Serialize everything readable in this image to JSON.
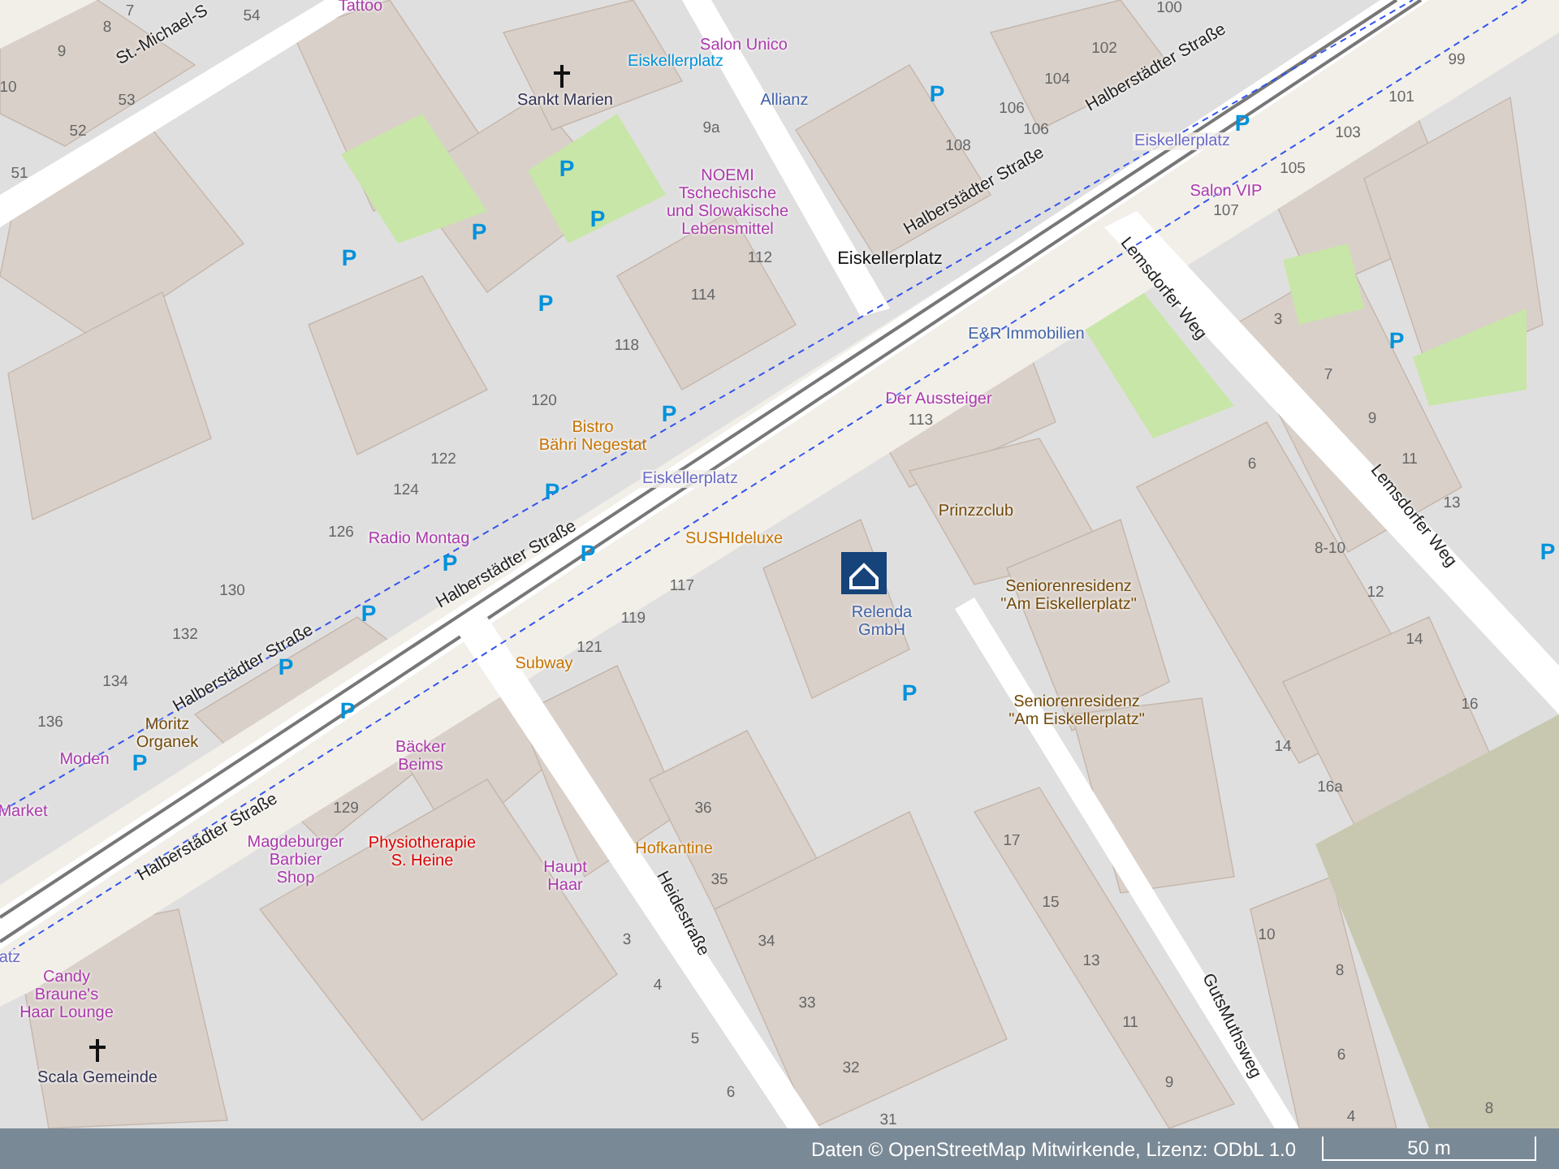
{
  "map": {
    "labels": [
      {
        "text": "St.-Michael-S",
        "kind": "street"
      },
      {
        "text": "Halberstädter Straße",
        "kind": "street"
      },
      {
        "text": "Halberstädter Straße",
        "kind": "street"
      },
      {
        "text": "Halberstädter Straße",
        "kind": "street"
      },
      {
        "text": "Halberstädter Straße",
        "kind": "street"
      },
      {
        "text": "Halberstädter Straße",
        "kind": "street"
      },
      {
        "text": "Lemsdorfer Weg",
        "kind": "street"
      },
      {
        "text": "Lemsdorfer Weg",
        "kind": "street"
      },
      {
        "text": "Heidestraße",
        "kind": "street"
      },
      {
        "text": "GutsMuthsweg",
        "kind": "street"
      },
      {
        "text": "Eiskellerplatz",
        "kind": "square"
      },
      {
        "text": "Tattoo",
        "kind": "shop"
      },
      {
        "text": "Salon Unico",
        "kind": "shop"
      },
      {
        "text": "Eiskellerplatz",
        "kind": "bus"
      },
      {
        "text": "Sankt Marien",
        "kind": "church"
      },
      {
        "text": "Allianz",
        "kind": "office"
      },
      {
        "text": "NOEMI\nTschechische\nund Slowakische\nLebensmittel",
        "kind": "shop"
      },
      {
        "text": "Eiskellerplatz",
        "kind": "tram"
      },
      {
        "text": "Salon VIP",
        "kind": "shop"
      },
      {
        "text": "E&R Immobilien",
        "kind": "office"
      },
      {
        "text": "Der Aussteiger",
        "kind": "shop"
      },
      {
        "text": "Bistro\nBähri Negestat",
        "kind": "food"
      },
      {
        "text": "Eiskellerplatz",
        "kind": "tram"
      },
      {
        "text": "Radio Montag",
        "kind": "shop"
      },
      {
        "text": "Prinzzclub",
        "kind": "leisure"
      },
      {
        "text": "SUSHIdeluxe",
        "kind": "food"
      },
      {
        "text": "Relenda\nGmbH",
        "kind": "office"
      },
      {
        "text": "Seniorenresidenz\n\"Am Eiskellerplatz\"",
        "kind": "leisure"
      },
      {
        "text": "Seniorenresidenz\n\"Am Eiskellerplatz\"",
        "kind": "leisure"
      },
      {
        "text": "Subway",
        "kind": "food"
      },
      {
        "text": "Moritz\nOrganek",
        "kind": "leisure"
      },
      {
        "text": "Moden",
        "kind": "shop"
      },
      {
        "text": "Market",
        "kind": "shop"
      },
      {
        "text": "Bäcker\nBeims",
        "kind": "shop"
      },
      {
        "text": "Magdeburger\nBarbier\nShop",
        "kind": "shop"
      },
      {
        "text": "Physiotherapie\nS. Heine",
        "kind": "health"
      },
      {
        "text": "Haupt\nHaar",
        "kind": "shop"
      },
      {
        "text": "Hofkantine",
        "kind": "food"
      },
      {
        "text": "Candy\nBraune's\nHaar Lounge",
        "kind": "shop"
      },
      {
        "text": "Scala Gemeinde",
        "kind": "church"
      },
      {
        "text": "atz",
        "kind": "tram"
      },
      {
        "text": "7",
        "kind": "number"
      },
      {
        "text": "8",
        "kind": "number"
      },
      {
        "text": "54",
        "kind": "number"
      },
      {
        "text": "9",
        "kind": "number"
      },
      {
        "text": "10",
        "kind": "number"
      },
      {
        "text": "53",
        "kind": "number"
      },
      {
        "text": "52",
        "kind": "number"
      },
      {
        "text": "51",
        "kind": "number"
      },
      {
        "text": "9a",
        "kind": "number"
      },
      {
        "text": "112",
        "kind": "number"
      },
      {
        "text": "114",
        "kind": "number"
      },
      {
        "text": "118",
        "kind": "number"
      },
      {
        "text": "120",
        "kind": "number"
      },
      {
        "text": "122",
        "kind": "number"
      },
      {
        "text": "124",
        "kind": "number"
      },
      {
        "text": "126",
        "kind": "number"
      },
      {
        "text": "130",
        "kind": "number"
      },
      {
        "text": "132",
        "kind": "number"
      },
      {
        "text": "134",
        "kind": "number"
      },
      {
        "text": "136",
        "kind": "number"
      },
      {
        "text": "129",
        "kind": "number"
      },
      {
        "text": "119",
        "kind": "number"
      },
      {
        "text": "121",
        "kind": "number"
      },
      {
        "text": "117",
        "kind": "number"
      },
      {
        "text": "100",
        "kind": "number"
      },
      {
        "text": "102",
        "kind": "number"
      },
      {
        "text": "104",
        "kind": "number"
      },
      {
        "text": "106",
        "kind": "number"
      },
      {
        "text": "106",
        "kind": "number"
      },
      {
        "text": "108",
        "kind": "number"
      },
      {
        "text": "99",
        "kind": "number"
      },
      {
        "text": "101",
        "kind": "number"
      },
      {
        "text": "103",
        "kind": "number"
      },
      {
        "text": "105",
        "kind": "number"
      },
      {
        "text": "107",
        "kind": "number"
      },
      {
        "text": "113",
        "kind": "number"
      },
      {
        "text": "3",
        "kind": "number"
      },
      {
        "text": "7",
        "kind": "number"
      },
      {
        "text": "9",
        "kind": "number"
      },
      {
        "text": "11",
        "kind": "number"
      },
      {
        "text": "13",
        "kind": "number"
      },
      {
        "text": "6",
        "kind": "number"
      },
      {
        "text": "8-10",
        "kind": "number"
      },
      {
        "text": "12",
        "kind": "number"
      },
      {
        "text": "14",
        "kind": "number"
      },
      {
        "text": "16",
        "kind": "number"
      },
      {
        "text": "14",
        "kind": "number"
      },
      {
        "text": "16a",
        "kind": "number"
      },
      {
        "text": "36",
        "kind": "number"
      },
      {
        "text": "35",
        "kind": "number"
      },
      {
        "text": "3",
        "kind": "number"
      },
      {
        "text": "34",
        "kind": "number"
      },
      {
        "text": "4",
        "kind": "number"
      },
      {
        "text": "5",
        "kind": "number"
      },
      {
        "text": "6",
        "kind": "number"
      },
      {
        "text": "33",
        "kind": "number"
      },
      {
        "text": "32",
        "kind": "number"
      },
      {
        "text": "31",
        "kind": "number"
      },
      {
        "text": "17",
        "kind": "number"
      },
      {
        "text": "15",
        "kind": "number"
      },
      {
        "text": "13",
        "kind": "number"
      },
      {
        "text": "11",
        "kind": "number"
      },
      {
        "text": "9",
        "kind": "number"
      },
      {
        "text": "10",
        "kind": "number"
      },
      {
        "text": "8",
        "kind": "number"
      },
      {
        "text": "6",
        "kind": "number"
      },
      {
        "text": "4",
        "kind": "number"
      },
      {
        "text": "8",
        "kind": "number"
      },
      {
        "text": "P",
        "kind": "parking"
      },
      {
        "text": "P",
        "kind": "parking"
      },
      {
        "text": "P",
        "kind": "parking"
      },
      {
        "text": "P",
        "kind": "parking"
      },
      {
        "text": "P",
        "kind": "parking"
      },
      {
        "text": "P",
        "kind": "parking"
      },
      {
        "text": "P",
        "kind": "parking"
      },
      {
        "text": "P",
        "kind": "parking"
      },
      {
        "text": "P",
        "kind": "parking"
      },
      {
        "text": "P",
        "kind": "parking"
      },
      {
        "text": "P",
        "kind": "parking"
      },
      {
        "text": "P",
        "kind": "parking"
      },
      {
        "text": "P",
        "kind": "parking"
      },
      {
        "text": "P",
        "kind": "parking"
      },
      {
        "text": "P",
        "kind": "parking"
      },
      {
        "text": "P",
        "kind": "parking"
      },
      {
        "text": "P",
        "kind": "parking"
      },
      {
        "text": "P",
        "kind": "parking"
      }
    ]
  },
  "attribution": {
    "prefix": "Daten ©",
    "link": "OpenStreetMap Mitwirkende",
    "middle": ", Lizenz:",
    "license": "ODbL 1.0"
  },
  "scale": {
    "label": "50 m"
  }
}
